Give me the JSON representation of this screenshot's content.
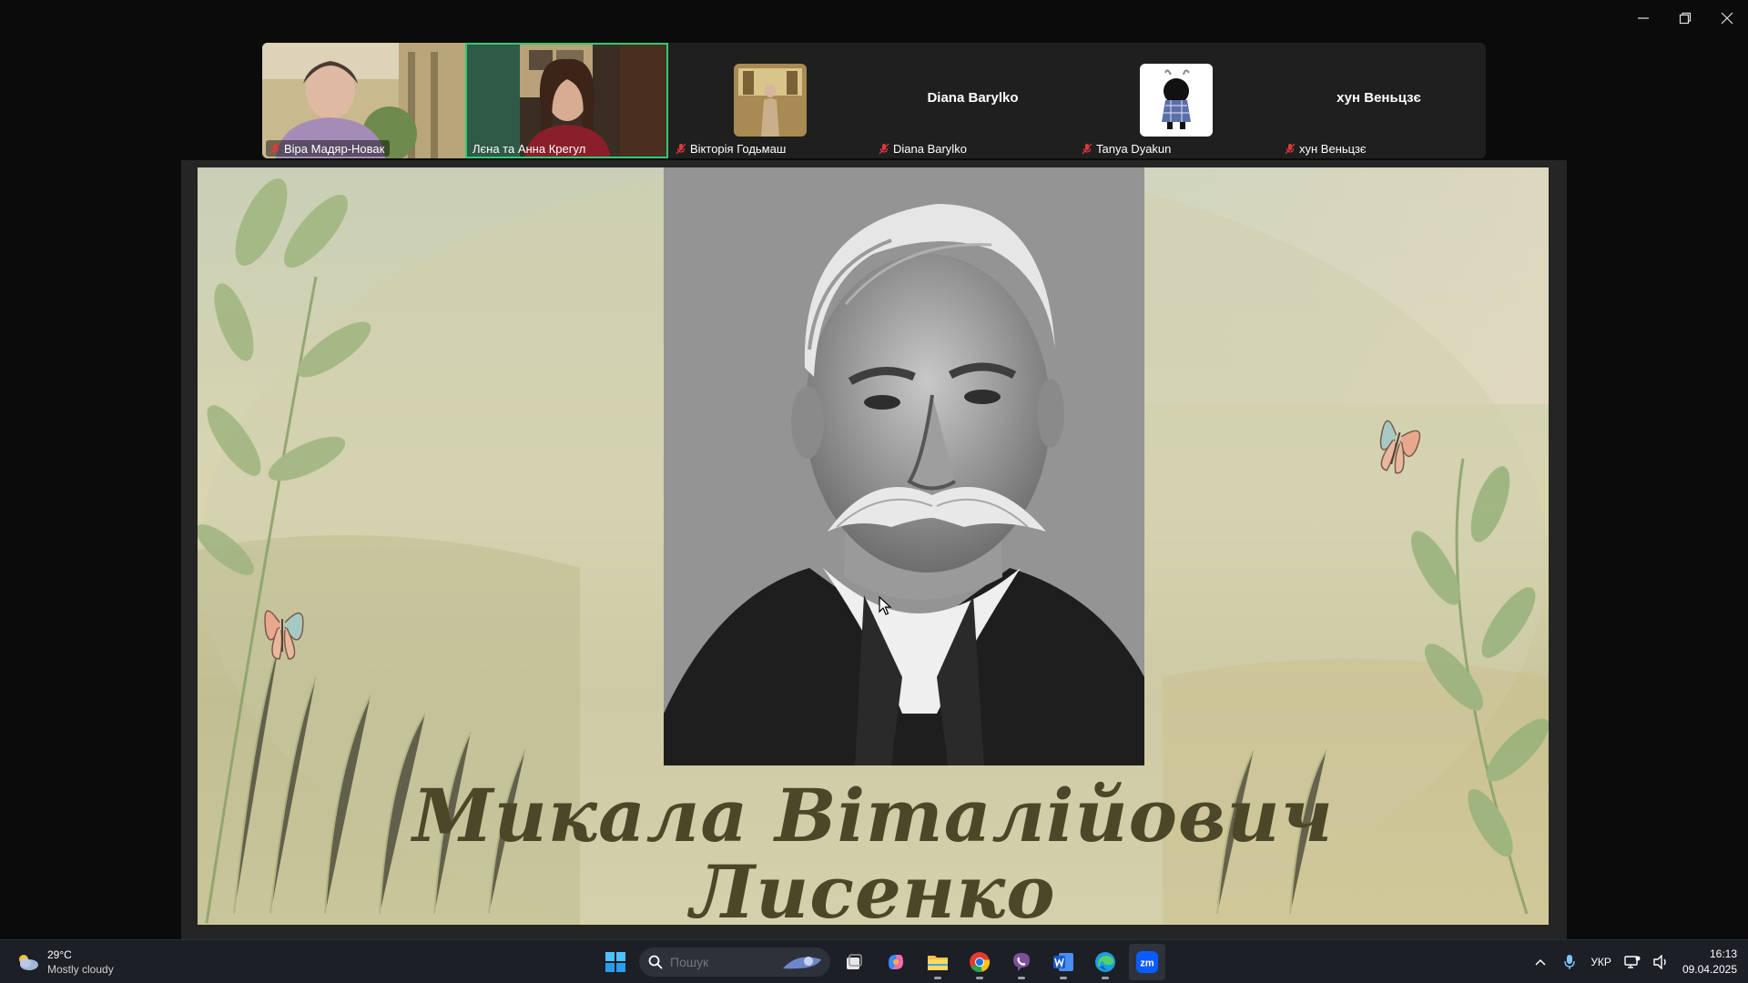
{
  "window": {
    "controls": [
      "minimize",
      "restore",
      "close"
    ]
  },
  "participants": [
    {
      "name": "Віра Мадяр-Новак",
      "muted": true,
      "video": true,
      "active": false
    },
    {
      "name": "Лєна та Анна Крегул",
      "muted": false,
      "video": true,
      "active": true
    },
    {
      "name": "Вікторія Годьмаш",
      "muted": true,
      "video": false,
      "avatar": "photo"
    },
    {
      "name": "Diana Barylko",
      "display_name": "Diana Barylko",
      "muted": true,
      "video": false
    },
    {
      "name": "Tanya Dyakun",
      "muted": true,
      "video": false,
      "avatar": "cartoon"
    },
    {
      "name": "хун Веньцзє",
      "display_name": "хун Веньцзє",
      "muted": true,
      "video": false
    }
  ],
  "slide": {
    "title_line1": "Микала Віталійович",
    "title_line2": "Лисенко"
  },
  "taskbar": {
    "weather": {
      "temp": "29°C",
      "desc": "Mostly cloudy"
    },
    "search_placeholder": "Пошук",
    "apps": [
      "start-icon",
      "search",
      "task-view-icon",
      "copilot-icon",
      "file-explorer-icon",
      "chrome-icon",
      "viber-icon",
      "word-icon",
      "edge-icon",
      "zoom-icon"
    ],
    "language": "УКР",
    "time": "16:13",
    "date": "09.04.2025"
  },
  "colors": {
    "active_speaker": "#2ecc71",
    "taskbar": "#1c1f26",
    "slide_title": "#4b4728",
    "mic_muted": "#e0383e"
  }
}
